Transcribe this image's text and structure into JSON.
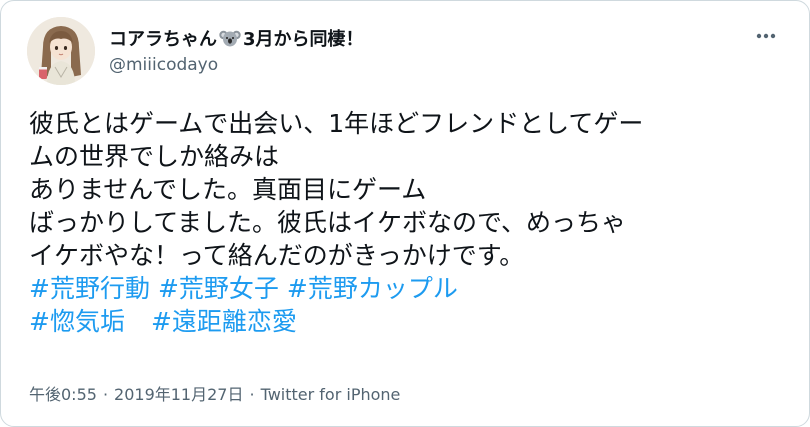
{
  "user": {
    "display_name": "コアラちゃん",
    "name_suffix": "3月から同棲！",
    "emoji_icon": "koala-icon",
    "handle": "@miiicodayo"
  },
  "tweet": {
    "lines": [
      "彼氏とはゲームで出会い、1年ほどフレンドとしてゲー",
      "ムの世界でしか絡みは",
      "ありませんでした。真面目にゲーム",
      "ばっかりしてました。彼氏はイケボなので、めっちゃ",
      "イケボやな！って絡んだのがきっかけです。"
    ],
    "hashtags": [
      "#荒野行動",
      "#荒野女子",
      "#荒野カップル",
      "#惚気垢",
      "#遠距離恋愛"
    ]
  },
  "meta": {
    "time": "午後0:55",
    "separator": "·",
    "date": "2019年11月27日",
    "source": "Twitter for iPhone"
  },
  "colors": {
    "text": "#0f1419",
    "secondary": "#536471",
    "link": "#1d9bf0",
    "border": "#cfd9de"
  }
}
